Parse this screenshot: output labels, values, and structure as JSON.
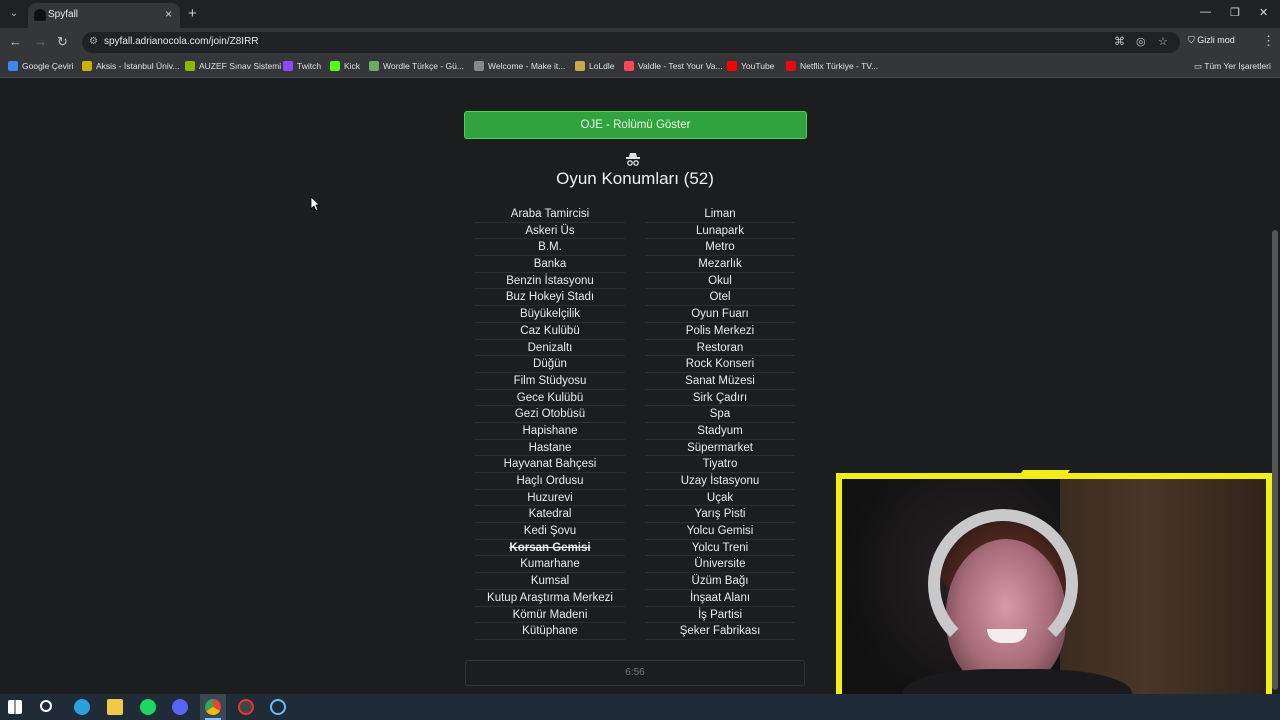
{
  "browser": {
    "tab_title": "Spyfall",
    "url": "spyfall.adrianocola.com/join/Z8IRR",
    "incognito_label": "Gizli mod",
    "bookmarks": [
      {
        "label": "Google Çeviri",
        "color": "#4285f4"
      },
      {
        "label": "Aksis - İstanbul Üniv...",
        "color": "#c8b400"
      },
      {
        "label": "AUZEF Sınav Sistemi",
        "color": "#8bb800"
      },
      {
        "label": "Twitch",
        "color": "#9146ff"
      },
      {
        "label": "Kick",
        "color": "#53fc18"
      },
      {
        "label": "Wordle Türkçe - Gü...",
        "color": "#6aaa64"
      },
      {
        "label": "Welcome - Make it...",
        "color": "#888888"
      },
      {
        "label": "LoLdle",
        "color": "#c9a84c"
      },
      {
        "label": "Valdle - Test Your Va...",
        "color": "#ff4655"
      },
      {
        "label": "YouTube",
        "color": "#ff0000"
      },
      {
        "label": "Netflix Türkiye - TV...",
        "color": "#e50914"
      }
    ],
    "all_bookmarks_label": "Tüm Yer İşaretleri"
  },
  "game": {
    "role_button_label": "OJE - Rolümü Göster",
    "locations_title": "Oyun Konumları (52)",
    "locations_left": [
      "Araba Tamircisi",
      "Askeri Üs",
      "B.M.",
      "Banka",
      "Benzin İstasyonu",
      "Buz Hokeyi Stadı",
      "Büyükelçilik",
      "Caz Kulübü",
      "Denizaltı",
      "Düğün",
      "Film Stüdyosu",
      "Gece Kulübü",
      "Gezi Otobüsü",
      "Hapishane",
      "Hastane",
      "Hayvanat Bahçesi",
      "Haçlı Ordusu",
      "Huzurevi",
      "Katedral",
      "Kedi Şovu",
      "Korsan Gemisi",
      "Kumarhane",
      "Kumsal",
      "Kutup Araştırma Merkezi",
      "Kömür Madeni",
      "Kütüphane"
    ],
    "struck_location": "Korsan Gemisi",
    "locations_right": [
      "Liman",
      "Lunapark",
      "Metro",
      "Mezarlık",
      "Okul",
      "Otel",
      "Oyun Fuarı",
      "Polis Merkezi",
      "Restoran",
      "Rock Konseri",
      "Sanat Müzesi",
      "Sirk Çadırı",
      "Spa",
      "Stadyum",
      "Süpermarket",
      "Tiyatro",
      "Uzay İstasyonu",
      "Uçak",
      "Yarış Pisti",
      "Yolcu Gemisi",
      "Yolcu Treni",
      "Üniversite",
      "Üzüm Bağı",
      "İnşaat Alanı",
      "İş Partisi",
      "Şeker Fabrikası"
    ],
    "timer": "6:56"
  },
  "colors": {
    "role_button": "#2fa33d",
    "webcam_frame": "#f2ee1a",
    "page_background": "#1b1d1f"
  }
}
